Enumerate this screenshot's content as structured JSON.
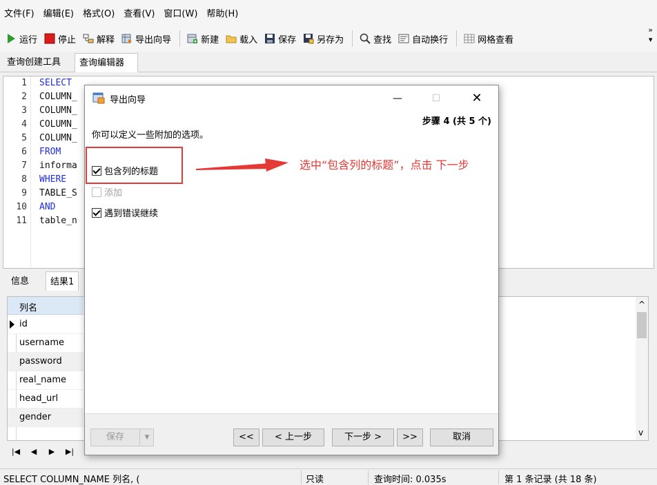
{
  "menu": [
    "文件(F)",
    "编辑(E)",
    "格式(O)",
    "查看(V)",
    "窗口(W)",
    "帮助(H)"
  ],
  "toolbar": {
    "run": "运行",
    "stop": "停止",
    "explain": "解释",
    "export_wizard": "导出向导",
    "new": "新建",
    "load": "载入",
    "save": "保存",
    "save_as": "另存为",
    "find": "查找",
    "word_wrap": "自动换行",
    "grid_view": "网格查看",
    "more": "»"
  },
  "tabs": [
    "查询创建工具",
    "查询编辑器"
  ],
  "editor": {
    "line_numbers": [
      "1",
      "2",
      "3",
      "4",
      "5",
      "6",
      "7",
      "8",
      "9",
      "10",
      "11"
    ],
    "lines": [
      "SELECT",
      "COLUMN_",
      "COLUMN_",
      "COLUMN_",
      "COLUMN_",
      "FROM",
      "informa",
      "WHERE",
      "TABLE_S",
      "AND",
      "table_n"
    ]
  },
  "result_tabs": [
    "信息",
    "结果1"
  ],
  "grid": {
    "header": "列名",
    "rows": [
      "id",
      "username",
      "password",
      "real_name",
      "head_url",
      "gender"
    ]
  },
  "nav_buttons": [
    "|◀",
    "◀",
    "▶",
    "▶|"
  ],
  "status": {
    "sql": "SELECT COLUMN_NAME 列名, (",
    "readonly": "只读",
    "query_time": "查询时间: 0.035s",
    "record": "第 1 条记录 (共 18 条)"
  },
  "dialog": {
    "title": "导出向导",
    "step": "步骤 4 (共 5 个)",
    "description": "你可以定义一些附加的选项。",
    "options": [
      {
        "label": "包含列的标题",
        "checked": true,
        "enabled": true
      },
      {
        "label": "添加",
        "checked": false,
        "enabled": false
      },
      {
        "label": "遇到错误继续",
        "checked": true,
        "enabled": true
      }
    ],
    "buttons": {
      "save": "保存",
      "first": "<<",
      "prev": "< 上一步",
      "next": "下一步 >",
      "last": ">>",
      "cancel": "取消"
    }
  },
  "annotation": "选中“包含列的标题”，点击 下一步",
  "colors": {
    "annotation_red": "#e53935",
    "keyword_blue": "#1e2ddb",
    "grid_header": "#dbe9f7"
  }
}
